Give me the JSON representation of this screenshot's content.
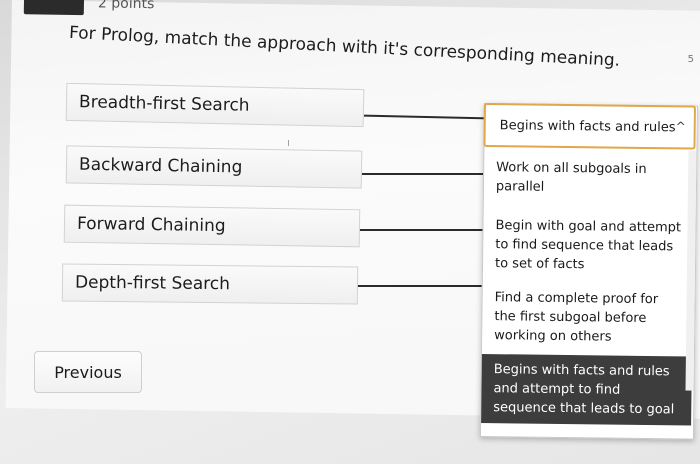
{
  "header": {
    "points_label": "2 points"
  },
  "question": {
    "text": "For Prolog, match the approach with it's corresponding meaning."
  },
  "terms": [
    {
      "label": "Breadth-first Search"
    },
    {
      "label": "Backward Chaining"
    },
    {
      "label": "Forward Chaining"
    },
    {
      "label": "Depth-first Search"
    }
  ],
  "dropdown": {
    "selected_value": "Begins with facts and rules",
    "chevron": "^",
    "options": [
      {
        "label": "Work on all subgoals in parallel",
        "highlighted": false
      },
      {
        "label": "Begin with goal and attempt to find sequence that leads to set of facts",
        "highlighted": false
      },
      {
        "label": "Find a complete proof for the first subgoal before working on others",
        "highlighted": false
      },
      {
        "label": "Begins with facts and rules and attempt to find sequence that leads to goal",
        "highlighted": true
      }
    ]
  },
  "navigation": {
    "previous_label": "Previous"
  },
  "side_mark": "5"
}
